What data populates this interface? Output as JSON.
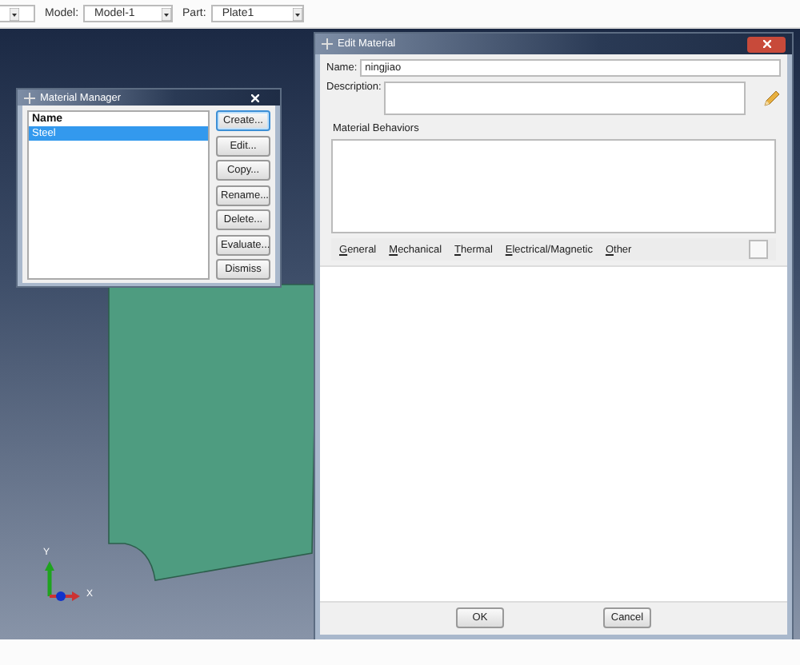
{
  "toolbar": {
    "fields": [
      {
        "label": "Model:",
        "value": "Model-1"
      },
      {
        "label": "Part:",
        "value": "Plate1"
      }
    ]
  },
  "viewport": {
    "triad": {
      "y_label": "Y",
      "x_label": "X"
    }
  },
  "material_manager": {
    "title": "Material Manager",
    "column": "Name",
    "rows": [
      {
        "name": "Steel",
        "selected": true
      }
    ],
    "buttons": [
      {
        "label": "Create...",
        "focused": true
      },
      {
        "label": "Edit...",
        "focused": false
      },
      {
        "label": "Copy...",
        "focused": false
      },
      {
        "label": "Rename...",
        "focused": false
      },
      {
        "label": "Delete...",
        "focused": false
      },
      {
        "label": "Evaluate...",
        "focused": false
      },
      {
        "label": "Dismiss",
        "focused": false
      }
    ]
  },
  "edit_material": {
    "title": "Edit Material",
    "name_label": "Name:",
    "name_value": "ningjiao",
    "description_label": "Description:",
    "behaviors_label": "Material Behaviors",
    "menus": [
      "General",
      "Mechanical",
      "Thermal",
      "Electrical/Magnetic",
      "Other"
    ],
    "buttons": [
      "OK",
      "Cancel"
    ]
  }
}
